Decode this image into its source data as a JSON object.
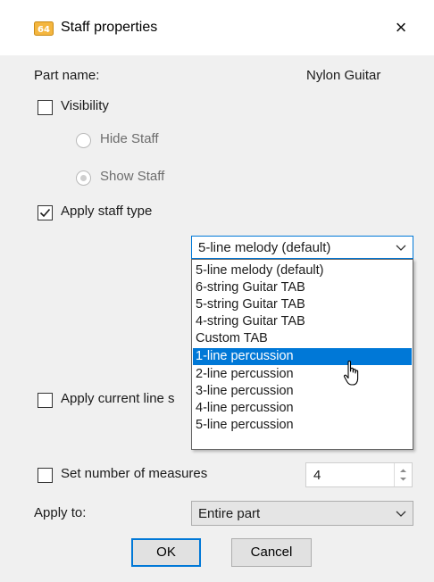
{
  "window": {
    "title": "Staff properties",
    "icon": "app-logo-icon",
    "close_icon": "close-icon",
    "close_glyph": "×"
  },
  "part": {
    "label": "Part name:",
    "value": "Nylon Guitar"
  },
  "visibility": {
    "label": "Visibility",
    "checked": false,
    "options": [
      "Hide Staff",
      "Show Staff"
    ],
    "selected": "Show Staff"
  },
  "staff_type": {
    "label": "Apply staff type",
    "checked": true,
    "selected": "5-line melody (default)",
    "options": [
      "5-line melody (default)",
      "6-string Guitar TAB",
      "5-string Guitar TAB",
      "4-string Guitar TAB",
      "Custom TAB",
      "1-line percussion",
      "2-line percussion",
      "3-line percussion",
      "4-line percussion",
      "5-line percussion"
    ],
    "highlighted": "1-line percussion"
  },
  "line_spacing": {
    "label": "Apply current line s",
    "checked": false
  },
  "measures": {
    "label": "Set number of measures",
    "checked": false,
    "value": "4"
  },
  "apply_to": {
    "label": "Apply to:",
    "value": "Entire part"
  },
  "buttons": {
    "ok": "OK",
    "cancel": "Cancel"
  },
  "colors": {
    "accent": "#0078d7",
    "background": "#f0f0f0"
  }
}
